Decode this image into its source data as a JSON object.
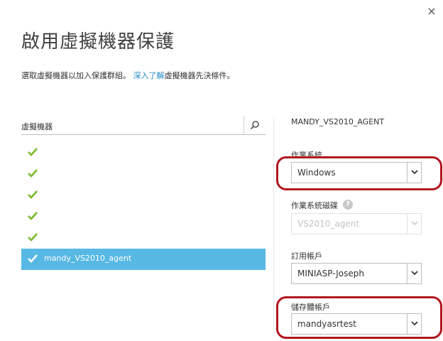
{
  "dialog": {
    "close_glyph": "×",
    "title": "啟用虛擬機器保護",
    "description_before": "選取虛擬機器以加入保護群組。",
    "description_link": "深入了解",
    "description_after": "虛擬機器先決條件。"
  },
  "vm_list": {
    "header": "虛擬機器",
    "items": [
      {
        "label": "",
        "checked": true,
        "selected": false
      },
      {
        "label": "",
        "checked": true,
        "selected": false
      },
      {
        "label": "",
        "checked": true,
        "selected": false
      },
      {
        "label": "",
        "checked": true,
        "selected": false
      },
      {
        "label": "",
        "checked": true,
        "selected": false
      },
      {
        "label": "mandy_VS2010_agent",
        "checked": true,
        "selected": true
      }
    ]
  },
  "details": {
    "vm_name": "MANDY_VS2010_AGENT",
    "os_label": "作業系統",
    "os_value": "Windows",
    "os_disk_label": "作業系統磁碟",
    "os_disk_value": "VS2010_agent",
    "os_disk_help": "?",
    "subscription_label": "訂用帳戶",
    "subscription_value": "MINIASP-Joseph",
    "storage_label": "儲存體帳戶",
    "storage_value": "mandyasrtest"
  },
  "colors": {
    "check_green": "#7ab929",
    "selected_bg": "#58b8e4",
    "link": "#1e88c6",
    "highlight_border": "#b0161e"
  }
}
